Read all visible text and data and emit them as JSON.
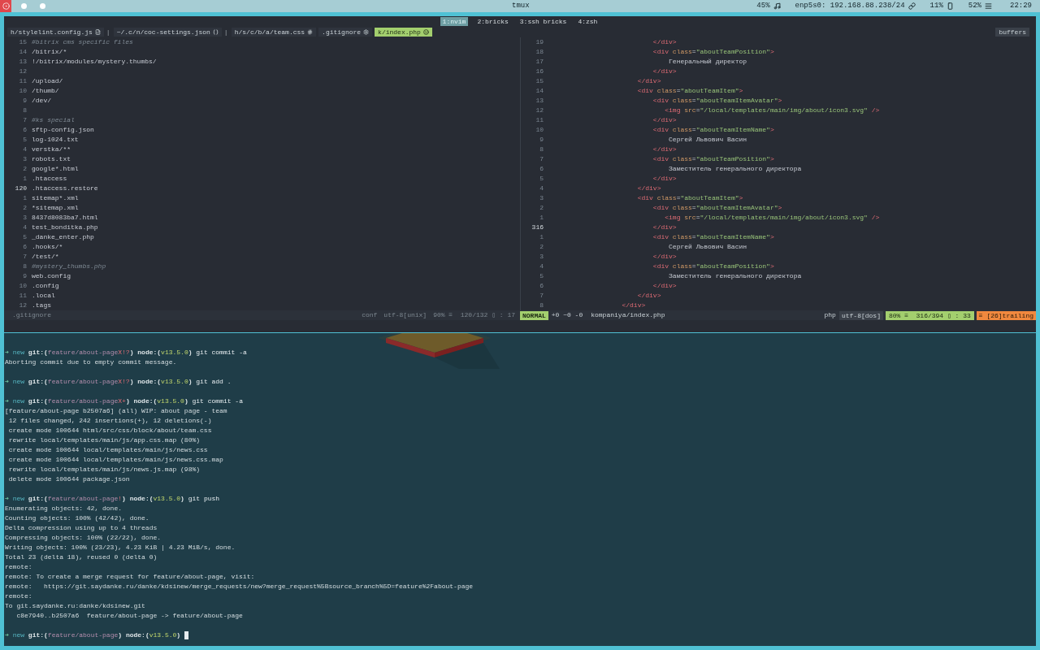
{
  "top_bar": {
    "title": "tmux",
    "status": [
      {
        "text": "45%"
      },
      {
        "text": "enp5s0: 192.168.88.238/24"
      },
      {
        "text": "11%"
      },
      {
        "text": "52%"
      }
    ],
    "clock": "22:29"
  },
  "tmux_windows": [
    {
      "label": "1:nvim",
      "selected": true
    },
    {
      "label": "2:bricks",
      "selected": false
    },
    {
      "label": "3:ssh bricks",
      "selected": false
    },
    {
      "label": "4:zsh",
      "selected": false
    }
  ],
  "buffer_tabs": [
    {
      "label": "h/stylelint.config.js",
      "divider": "|",
      "selected": false
    },
    {
      "label": "~/.c/n/coc-settings.json",
      "divider": "|",
      "selected": false
    },
    {
      "label": "h/s/c/b/a/team.css",
      "selected": false
    },
    {
      "label": ".gitignore",
      "selected": false
    },
    {
      "label": "k/index.php",
      "selected": true
    }
  ],
  "buffers_label": "buffers",
  "left_pane": {
    "lines": [
      {
        "number": "15",
        "text": "#bitrix cms specific files",
        "kind": "comment",
        "current": false
      },
      {
        "number": "14",
        "text": "/bitrix/*",
        "kind": "text",
        "current": false
      },
      {
        "number": "13",
        "text": "!/bitrix/modules/mystery.thumbs/",
        "kind": "text",
        "current": false
      },
      {
        "number": "12",
        "current": false
      },
      {
        "number": "11",
        "text": "/upload/",
        "kind": "text",
        "current": false
      },
      {
        "number": "10",
        "text": "/thumb/",
        "kind": "text",
        "current": false
      },
      {
        "number": "9",
        "text": "/dev/",
        "kind": "text",
        "current": false
      },
      {
        "number": "8",
        "current": false
      },
      {
        "number": "7",
        "text": "#ks special",
        "kind": "comment",
        "current": false
      },
      {
        "number": "6",
        "text": "sftp-config.json",
        "kind": "text",
        "current": false
      },
      {
        "number": "5",
        "text": "log-1024.txt",
        "kind": "text",
        "current": false
      },
      {
        "number": "4",
        "text": "verstka/**",
        "kind": "text",
        "current": false
      },
      {
        "number": "3",
        "text": "robots.txt",
        "kind": "text",
        "current": false
      },
      {
        "number": "2",
        "text": "google*.html",
        "kind": "text",
        "current": false
      },
      {
        "number": "1",
        "text": ".htaccess",
        "kind": "text",
        "current": false
      },
      {
        "number": "120",
        "text": ".htaccess.restore",
        "kind": "text",
        "current": true
      },
      {
        "number": "1",
        "text": "sitemap*.xml",
        "kind": "text",
        "current": false
      },
      {
        "number": "2",
        "text": "*sitemap.xml",
        "kind": "text",
        "current": false
      },
      {
        "number": "3",
        "text": "8437d8083ba7.html",
        "kind": "text",
        "current": false
      },
      {
        "number": "4",
        "text": "test_bonditka.php",
        "kind": "text",
        "current": false
      },
      {
        "number": "5",
        "text": "_danke_enter.php",
        "kind": "text",
        "current": false
      },
      {
        "number": "6",
        "text": ".hooks/*",
        "kind": "text",
        "current": false
      },
      {
        "number": "7",
        "text": "/test/*",
        "kind": "text",
        "current": false
      },
      {
        "number": "8",
        "text": "#mystery_thumbs.php",
        "kind": "comment",
        "current": false
      },
      {
        "number": "9",
        "text": "web.config",
        "kind": "text",
        "current": false
      },
      {
        "number": "10",
        "text": ".config",
        "kind": "text",
        "current": false
      },
      {
        "number": "11",
        "text": ".local",
        "kind": "text",
        "current": false
      },
      {
        "number": "12",
        "text": ".tags",
        "kind": "text",
        "current": false
      }
    ],
    "status": {
      "filename": ".gitignore",
      "filetype": "conf",
      "encoding": "utf-8[unix]",
      "position": "90% ≡  120/132 ▯ : 17"
    }
  },
  "right_pane": {
    "lines": [
      {
        "number": "19",
        "text": "                          </div>",
        "current": false
      },
      {
        "number": "18",
        "text": "                          <div class=\"aboutTeamPosition\">",
        "current": false
      },
      {
        "number": "17",
        "text": "                              Генеральный директор",
        "current": false
      },
      {
        "number": "16",
        "text": "                          </div>",
        "current": false
      },
      {
        "number": "15",
        "text": "                      </div>",
        "current": false
      },
      {
        "number": "14",
        "text": "                      <div class=\"aboutTeamItem\">",
        "current": false
      },
      {
        "number": "13",
        "text": "                          <div class=\"aboutTeamItemAvatar\">",
        "current": false
      },
      {
        "number": "12",
        "text": "                             <img src=\"/local/templates/main/img/about/icon3.svg\" />",
        "current": false
      },
      {
        "number": "11",
        "text": "                          </div>",
        "current": false
      },
      {
        "number": "10",
        "text": "                          <div class=\"aboutTeamItemName\">",
        "current": false
      },
      {
        "number": "9",
        "text": "                              Сергей Львович Васин",
        "current": false
      },
      {
        "number": "8",
        "text": "                          </div>",
        "current": false
      },
      {
        "number": "7",
        "text": "                          <div class=\"aboutTeamPosition\">",
        "current": false
      },
      {
        "number": "6",
        "text": "                              Заместитель генерального директора",
        "current": false
      },
      {
        "number": "5",
        "text": "                          </div>",
        "current": false
      },
      {
        "number": "4",
        "text": "                      </div>",
        "current": false
      },
      {
        "number": "3",
        "text": "                      <div class=\"aboutTeamItem\">",
        "current": false
      },
      {
        "number": "2",
        "text": "                          <div class=\"aboutTeamItemAvatar\">",
        "current": false
      },
      {
        "number": "1",
        "text": "                             <img src=\"/local/templates/main/img/about/icon3.svg\" />",
        "current": false
      },
      {
        "number": "316",
        "text": "                          </div>",
        "current": true
      },
      {
        "number": "1",
        "text": "                          <div class=\"aboutTeamItemName\">",
        "current": false
      },
      {
        "number": "2",
        "text": "                              Сергей Львович Васин",
        "current": false
      },
      {
        "number": "3",
        "text": "                          </div>",
        "current": false
      },
      {
        "number": "4",
        "text": "                          <div class=\"aboutTeamPosition\">",
        "current": false
      },
      {
        "number": "5",
        "text": "                              Заместитель генерального директора",
        "current": false
      },
      {
        "number": "6",
        "text": "                          </div>",
        "current": false
      },
      {
        "number": "7",
        "text": "                      </div>",
        "current": false
      },
      {
        "number": "8",
        "text": "                  </div>",
        "current": false
      }
    ],
    "status": {
      "mode": "NORMAL",
      "diff": "+0 ~0 -0",
      "filename": "kompaniya/index.php",
      "filetype": "php",
      "encoding": "utf-8[dos]",
      "position": "80% ≡  316/394 ▯ : 33",
      "warning": "≡ [26]trailing"
    }
  },
  "terminal": {
    "lines": [
      {
        "kind": "prompt",
        "segments": [
          {
            "kind": "arrow",
            "text": "➜"
          },
          {
            "kind": "dir",
            "text": " new"
          },
          {
            "kind": "label",
            "text": " git:("
          },
          {
            "kind": "branch",
            "text": "feature/about-page"
          },
          {
            "kind": "dirty",
            "text": "X!?"
          },
          {
            "kind": "label",
            "text": ")"
          },
          {
            "kind": "label",
            "text": " node:("
          },
          {
            "kind": "version",
            "text": "v13.5.0"
          },
          {
            "kind": "label",
            "text": ")"
          },
          {
            "kind": "command",
            "text": " git commit -a"
          }
        ]
      },
      {
        "kind": "output",
        "text": "Aborting commit due to empty commit message."
      },
      {
        "kind": "prompt",
        "segments": [
          {
            "kind": "arrow",
            "text": "➜"
          },
          {
            "kind": "dir",
            "text": " new"
          },
          {
            "kind": "label",
            "text": " git:("
          },
          {
            "kind": "branch",
            "text": "feature/about-page"
          },
          {
            "kind": "dirty",
            "text": "X!?"
          },
          {
            "kind": "label",
            "text": ")"
          },
          {
            "kind": "label",
            "text": " node:("
          },
          {
            "kind": "version",
            "text": "v13.5.0"
          },
          {
            "kind": "label",
            "text": ")"
          },
          {
            "kind": "command",
            "text": " git add ."
          }
        ]
      },
      {
        "kind": "prompt",
        "segments": [
          {
            "kind": "arrow",
            "text": "➜"
          },
          {
            "kind": "dir",
            "text": " new"
          },
          {
            "kind": "label",
            "text": " git:("
          },
          {
            "kind": "branch",
            "text": "feature/about-page"
          },
          {
            "kind": "dirty",
            "text": "X+"
          },
          {
            "kind": "label",
            "text": ")"
          },
          {
            "kind": "label",
            "text": " node:("
          },
          {
            "kind": "version",
            "text": "v13.5.0"
          },
          {
            "kind": "label",
            "text": ")"
          },
          {
            "kind": "command",
            "text": " git commit -a"
          }
        ]
      },
      {
        "kind": "output",
        "text": "[feature/about-page b2507a6] (all) WIP: about page - team"
      },
      {
        "kind": "output",
        "text": " 12 files changed, 242 insertions(+), 12 deletions(-)"
      },
      {
        "kind": "output",
        "text": " create mode 100644 html/src/css/block/about/team.css"
      },
      {
        "kind": "output",
        "text": " rewrite local/templates/main/js/app.css.map (80%)"
      },
      {
        "kind": "output",
        "text": " create mode 100644 local/templates/main/js/news.css"
      },
      {
        "kind": "output",
        "text": " create mode 100644 local/templates/main/js/news.css.map"
      },
      {
        "kind": "output",
        "text": " rewrite local/templates/main/js/news.js.map (98%)"
      },
      {
        "kind": "output",
        "text": " delete mode 100644 package.json"
      },
      {
        "kind": "prompt",
        "segments": [
          {
            "kind": "arrow",
            "text": "➜"
          },
          {
            "kind": "dir",
            "text": " new"
          },
          {
            "kind": "label",
            "text": " git:("
          },
          {
            "kind": "branch",
            "text": "feature/about-page"
          },
          {
            "kind": "dirty",
            "text": "!"
          },
          {
            "kind": "label",
            "text": ")"
          },
          {
            "kind": "label",
            "text": " node:("
          },
          {
            "kind": "version",
            "text": "v13.5.0"
          },
          {
            "kind": "label",
            "text": ")"
          },
          {
            "kind": "command",
            "text": " git push"
          }
        ]
      },
      {
        "kind": "output",
        "text": "Enumerating objects: 42, done."
      },
      {
        "kind": "output",
        "text": "Counting objects: 100% (42/42), done."
      },
      {
        "kind": "output",
        "text": "Delta compression using up to 4 threads"
      },
      {
        "kind": "output",
        "text": "Compressing objects: 100% (22/22), done."
      },
      {
        "kind": "output",
        "text": "Writing objects: 100% (23/23), 4.23 KiB | 4.23 MiB/s, done."
      },
      {
        "kind": "output",
        "text": "Total 23 (delta 18), reused 0 (delta 0)"
      },
      {
        "kind": "output",
        "text": "remote:"
      },
      {
        "kind": "output",
        "text": "remote: To create a merge request for feature/about-page, visit:"
      },
      {
        "kind": "output",
        "text": "remote:   https://git.saydanke.ru/danke/kdsinew/merge_requests/new?merge_request%5Bsource_branch%5D=feature%2Fabout-page"
      },
      {
        "kind": "output",
        "text": "remote:"
      },
      {
        "kind": "output",
        "text": "To git.saydanke.ru:danke/kdsinew.git"
      },
      {
        "kind": "output",
        "text": "   c8e7940..b2507a6  feature/about-page -> feature/about-page"
      },
      {
        "kind": "prompt",
        "cursor": true,
        "segments": [
          {
            "kind": "arrow",
            "text": "➜"
          },
          {
            "kind": "dir",
            "text": " new"
          },
          {
            "kind": "label",
            "text": " git:("
          },
          {
            "kind": "branch",
            "text": "feature/about-page"
          },
          {
            "kind": "label",
            "text": ")"
          },
          {
            "kind": "label",
            "text": " node:("
          },
          {
            "kind": "version",
            "text": "v13.5.0"
          },
          {
            "kind": "label",
            "text": ")"
          }
        ]
      }
    ]
  }
}
